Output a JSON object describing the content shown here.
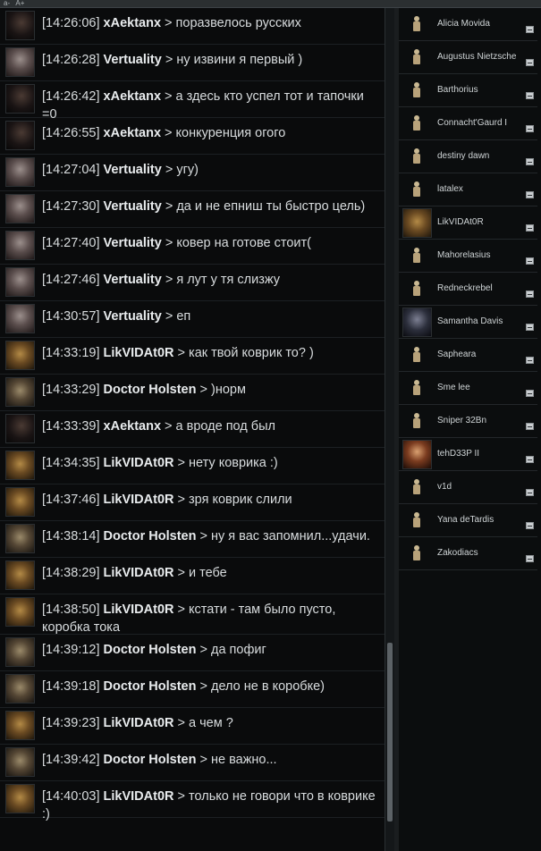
{
  "toolbar": {
    "font_minus": "a-",
    "font_plus": "A+"
  },
  "messages": [
    {
      "avatar": "xa",
      "time": "[14:26:06]",
      "name": "xAektanx",
      "sep": " > ",
      "text": "поразвелось русских"
    },
    {
      "avatar": "ve",
      "time": "[14:26:28]",
      "name": "Vertuality",
      "sep": " > ",
      "text": "ну извини я первый )"
    },
    {
      "avatar": "xa",
      "time": "[14:26:42]",
      "name": "xAektanx",
      "sep": " > ",
      "text": "а здесь кто успел тот и тапочки =0"
    },
    {
      "avatar": "xa",
      "time": "[14:26:55]",
      "name": "xAektanx",
      "sep": " > ",
      "text": "конкуренция огого"
    },
    {
      "avatar": "ve",
      "time": "[14:27:04]",
      "name": "Vertuality",
      "sep": " > ",
      "text": "угу)"
    },
    {
      "avatar": "ve",
      "time": "[14:27:30]",
      "name": "Vertuality",
      "sep": " > ",
      "text": "да и не епниш ты быстро цель)"
    },
    {
      "avatar": "ve",
      "time": "[14:27:40]",
      "name": "Vertuality",
      "sep": " > ",
      "text": "ковер на готове стоит("
    },
    {
      "avatar": "ve",
      "time": "[14:27:46]",
      "name": "Vertuality",
      "sep": " > ",
      "text": "я лут у тя слизжу"
    },
    {
      "avatar": "ve",
      "time": "[14:30:57]",
      "name": "Vertuality",
      "sep": " > ",
      "text": "еп"
    },
    {
      "avatar": "li",
      "time": "[14:33:19]",
      "name": "LikVIDAt0R",
      "sep": " > ",
      "text": "как твой коврик то? )"
    },
    {
      "avatar": "do",
      "time": "[14:33:29]",
      "name": "Doctor Holsten",
      "sep": " > ",
      "text": ")норм"
    },
    {
      "avatar": "xa",
      "time": "[14:33:39]",
      "name": "xAektanx",
      "sep": " > ",
      "text": "а вроде под был"
    },
    {
      "avatar": "li",
      "time": "[14:34:35]",
      "name": "LikVIDAt0R",
      "sep": " > ",
      "text": "нету коврика :)"
    },
    {
      "avatar": "li",
      "time": "[14:37:46]",
      "name": "LikVIDAt0R",
      "sep": " > ",
      "text": "зря коврик слили"
    },
    {
      "avatar": "do",
      "time": "[14:38:14]",
      "name": "Doctor Holsten",
      "sep": " > ",
      "text": "ну я вас запомнил...удачи."
    },
    {
      "avatar": "li",
      "time": "[14:38:29]",
      "name": "LikVIDAt0R",
      "sep": " > ",
      "text": "и тебе"
    },
    {
      "avatar": "li",
      "time": "[14:38:50]",
      "name": "LikVIDAt0R",
      "sep": " > ",
      "text": "кстати - там было пусто, коробка тока"
    },
    {
      "avatar": "do",
      "time": "[14:39:12]",
      "name": "Doctor Holsten",
      "sep": " > ",
      "text": "да пофиг"
    },
    {
      "avatar": "do",
      "time": "[14:39:18]",
      "name": "Doctor Holsten",
      "sep": " > ",
      "text": "дело не в коробке)"
    },
    {
      "avatar": "li",
      "time": "[14:39:23]",
      "name": "LikVIDAt0R",
      "sep": " > ",
      "text": "а чем ?"
    },
    {
      "avatar": "do",
      "time": "[14:39:42]",
      "name": "Doctor Holsten",
      "sep": " > ",
      "text": "не важно..."
    },
    {
      "avatar": "li",
      "time": "[14:40:03]",
      "name": "LikVIDAt0R",
      "sep": " > ",
      "text": "только не говори что в коврике :)"
    }
  ],
  "members": [
    {
      "name": "Alicia Movida",
      "portrait": ""
    },
    {
      "name": "Augustus Nietzsche",
      "portrait": ""
    },
    {
      "name": "Barthorius",
      "portrait": ""
    },
    {
      "name": "Connacht'Gaurd I",
      "portrait": ""
    },
    {
      "name": "destiny dawn",
      "portrait": ""
    },
    {
      "name": "latalex",
      "portrait": ""
    },
    {
      "name": "LikVIDAt0R",
      "portrait": "li"
    },
    {
      "name": "Mahorelasius",
      "portrait": ""
    },
    {
      "name": "Redneckrebel",
      "portrait": ""
    },
    {
      "name": "Samantha Davis",
      "portrait": "sa"
    },
    {
      "name": "Sapheara",
      "portrait": ""
    },
    {
      "name": "Sme lee",
      "portrait": ""
    },
    {
      "name": "Sniper 32Bn",
      "portrait": ""
    },
    {
      "name": "tehD33P II",
      "portrait": "te"
    },
    {
      "name": "v1d",
      "portrait": ""
    },
    {
      "name": "Yana deTardis",
      "portrait": ""
    },
    {
      "name": "Zakodiacs",
      "portrait": ""
    }
  ]
}
